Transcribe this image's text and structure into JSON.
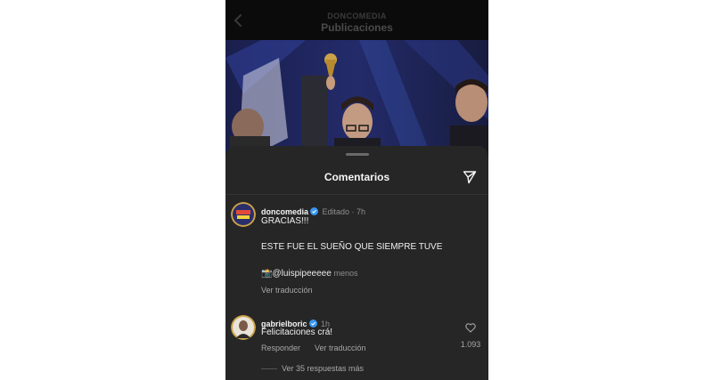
{
  "header": {
    "account": "DONCOMEDIA",
    "title": "Publicaciones"
  },
  "sheet": {
    "title": "Comentarios"
  },
  "comments": [
    {
      "username": "doncomedia",
      "edited": "Editado",
      "time": "7h",
      "line1": "GRACIAS!!!",
      "line2": "ESTE FUE EL SUEÑO QUE SIEMPRE TUVE",
      "emoji": "📸",
      "mention": "@luispipeeeee",
      "less": "menos",
      "translate": "Ver traducción"
    },
    {
      "username": "gabrielboric",
      "time": "1h",
      "text": "Felicitaciones crá!",
      "reply": "Responder",
      "translate": "Ver traducción",
      "likes": "1.093",
      "more_replies": "Ver 35 respuestas más"
    }
  ],
  "colors": {
    "verified": "#3897f0",
    "sheet": "#262626"
  }
}
